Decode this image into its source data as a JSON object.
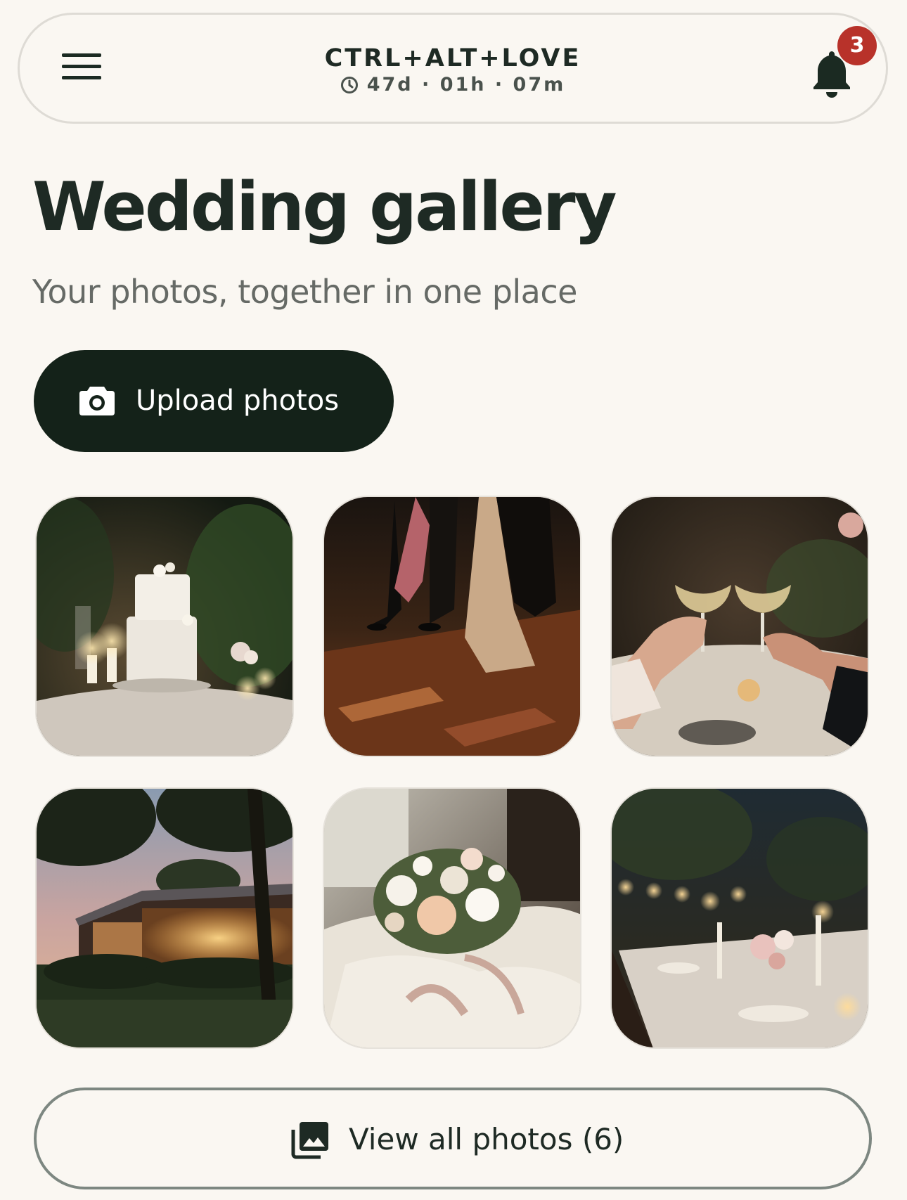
{
  "header": {
    "brand": "CTRL+ALT+LOVE",
    "countdown": "47d · 01h · 07m",
    "notification_count": "3"
  },
  "page": {
    "title": "Wedding gallery",
    "subtitle": "Your photos, together in one place"
  },
  "upload_button": {
    "label": "Upload photos"
  },
  "gallery": {
    "photos": [
      {
        "subject": "wedding cake with candles"
      },
      {
        "subject": "guests dancing"
      },
      {
        "subject": "champagne toast"
      },
      {
        "subject": "venue at dusk"
      },
      {
        "subject": "bridal bouquet"
      },
      {
        "subject": "candlelit reception table"
      }
    ]
  },
  "view_all_button": {
    "label": "View all photos (6)"
  },
  "colors": {
    "background": "#faf7f2",
    "primary_dark": "#142219",
    "badge": "#b8322a",
    "outline": "#7d8781"
  }
}
